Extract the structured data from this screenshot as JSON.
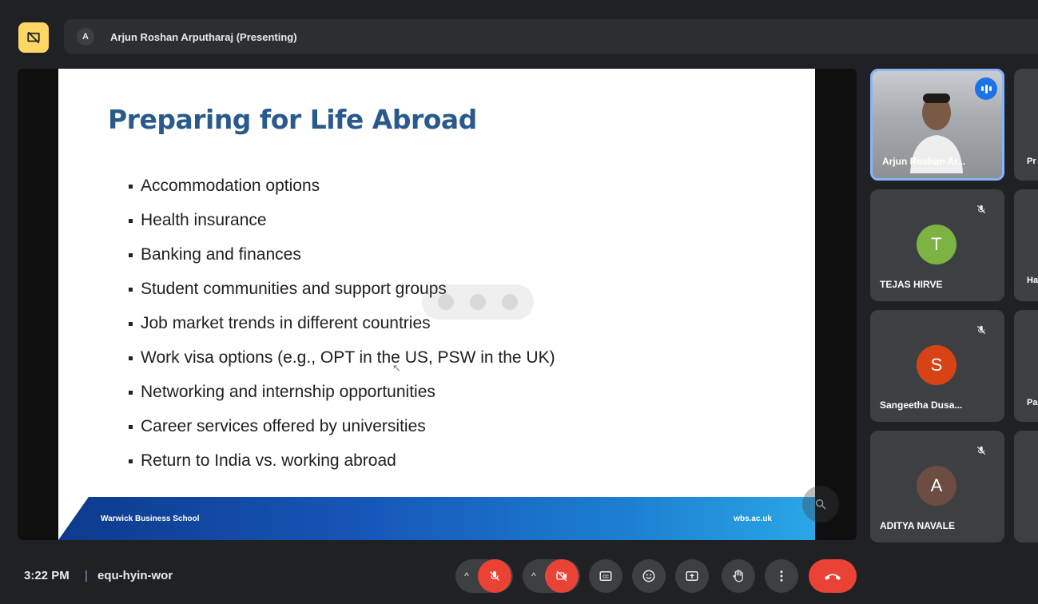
{
  "header": {
    "presenter_initial": "A",
    "presenter_label": "Arjun Roshan Arputharaj (Presenting)",
    "present_icon": "presentation-off-icon"
  },
  "slide": {
    "title": "Preparing for Life Abroad",
    "bullets": [
      "Accommodation options",
      "Health insurance",
      "Banking and finances",
      "Student communities and support groups",
      "Job market trends in different countries",
      "Work visa options (e.g., OPT in the US, PSW in the UK)",
      "Networking and internship opportunities",
      "Career services offered by universities",
      "Return to India vs. working abroad"
    ],
    "footer_left": "Warwick Business School",
    "footer_right": "wbs.ac.uk"
  },
  "participants": [
    {
      "name": "Arjun Roshan Ar...",
      "speaking": true,
      "video": true
    },
    {
      "name": "TEJAS HIRVE",
      "initial": "T",
      "color": "#7cb342",
      "muted": true
    },
    {
      "name": "Sangeetha Dusa...",
      "initial": "S",
      "color": "#d84315",
      "muted": true
    },
    {
      "name": "ADITYA NAVALE",
      "initial": "A",
      "color": "#6d4c41",
      "muted": true
    }
  ],
  "partial_participants": [
    "Pr",
    "Ha",
    "Pa",
    ""
  ],
  "footer": {
    "time": "3:22 PM",
    "separator": "|",
    "meeting_code": "equ-hyin-wor"
  },
  "controls": [
    {
      "name": "mic-button",
      "icon": "mic-off-icon",
      "state": "off"
    },
    {
      "name": "camera-button",
      "icon": "camera-off-icon",
      "state": "off"
    },
    {
      "name": "captions-button",
      "icon": "captions-icon"
    },
    {
      "name": "reactions-button",
      "icon": "emoji-icon"
    },
    {
      "name": "present-button",
      "icon": "present-screen-icon"
    },
    {
      "name": "raise-hand-button",
      "icon": "hand-icon"
    },
    {
      "name": "more-options-button",
      "icon": "more-vert-icon"
    },
    {
      "name": "end-call-button",
      "icon": "end-call-icon"
    }
  ],
  "colors": {
    "background": "#202124",
    "surface": "#3c4043",
    "accent_blue": "#8ab4f8",
    "danger_red": "#ea4335",
    "present_yellow": "#fdd663",
    "slide_title_blue": "#2a5a8c"
  }
}
